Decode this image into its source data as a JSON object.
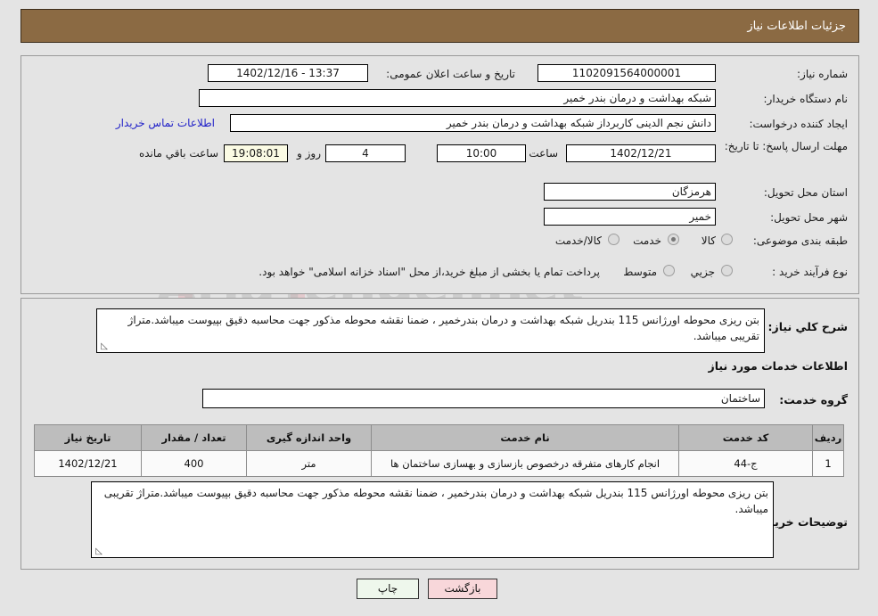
{
  "header": {
    "title": "جزئیات اطلاعات نیاز"
  },
  "watermark": {
    "text": "AriaTender.net",
    "shield": "shield-logo"
  },
  "form": {
    "need_number": {
      "label": "شماره نیاز:",
      "value": "1102091564000001"
    },
    "buyer_org": {
      "label": "نام دستگاه خریدار:",
      "value": "شبکه بهداشت و درمان بندر خمیر"
    },
    "requester": {
      "label": "ایجاد کننده درخواست:",
      "value": "دانش نجم الدینی کاربرداز شبکه بهداشت و درمان بندر خمیر"
    },
    "deadline": {
      "label": "مهلت ارسال پاسخ: تا تاریخ:",
      "value": "1402/12/21"
    },
    "announce": {
      "label": "تاریخ و ساعت اعلان عمومی:",
      "value": "13:37 - 1402/12/16"
    },
    "contact_link": {
      "label": "اطلاعات تماس خریدار"
    },
    "time_label": "ساعت",
    "time_value": "10:00",
    "days_value": "4",
    "days_suffix": "روز و",
    "countdown_value": "19:08:01",
    "countdown_suffix": "ساعت باقي مانده",
    "province": {
      "label": "استان محل تحویل:",
      "value": "هرمزگان"
    },
    "city": {
      "label": "شهر محل تحویل:",
      "value": "خمیر"
    },
    "category": {
      "label": "طبقه بندی موضوعی:",
      "options": [
        "کالا",
        "خدمت",
        "کالا/خدمت"
      ],
      "selected": "خدمت"
    },
    "process_type": {
      "label": "نوع فرآیند خرید :",
      "options": [
        "جزیي",
        "متوسط"
      ],
      "selected": "",
      "note": "پرداخت تمام یا بخشی از مبلغ خرید،از محل \"اسناد خزانه اسلامی\" خواهد بود."
    }
  },
  "description": {
    "need_label": "شرح کلي نیاز:",
    "need_text": "بتن ریزی محوطه اورژانس 115 بندریل شبکه بهداشت و درمان بندرخمیر ، ضمنا نقشه محوطه مذکور جهت محاسبه دقیق بپیوست میباشد.متراژ تقریبی میباشد.",
    "services_head": "اطلاعات خدمات مورد نیاز",
    "service_group": {
      "label": "گروه خدمت:",
      "value": "ساختمان"
    },
    "buyer_notes_label": "توضیحات خریدار:",
    "buyer_notes_text": "بتن ریزی محوطه اورژانس 115 بندریل شبکه بهداشت و درمان بندرخمیر ، ضمنا نقشه محوطه مذکور جهت محاسبه دقیق بپیوست میباشد.متراژ تقریبی میباشد."
  },
  "table": {
    "headers": [
      "ردیف",
      "کد خدمت",
      "نام خدمت",
      "واحد اندازه گیری",
      "تعداد / مقدار",
      "تاریخ نیاز"
    ],
    "rows": [
      {
        "index": "1",
        "code": "ج-44",
        "name": "انجام کارهای متفرقه درخصوص بازسازی و بهسازی ساختمان ها",
        "unit": "متر",
        "qty": "400",
        "date": "1402/12/21"
      }
    ]
  },
  "footer": {
    "back_label": "بازگشت",
    "print_label": "چاپ"
  },
  "colors": {
    "header_bg": "#8b6a43",
    "page_bg": "#e4e4e4",
    "link": "#1f1fc8",
    "timer_bg": "#fbfbe4",
    "back_btn": "#f8d7da",
    "print_btn": "#eef7ec",
    "table_header": "#bdbdbd"
  }
}
